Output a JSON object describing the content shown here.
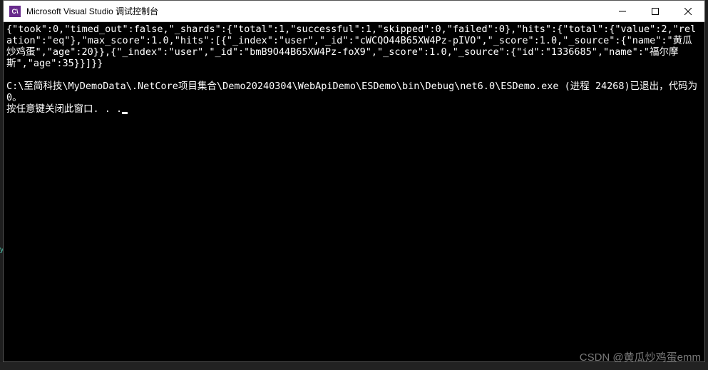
{
  "titlebar": {
    "icon_text": "C\\",
    "title": "Microsoft Visual Studio 调试控制台"
  },
  "console": {
    "json_output": "{\"took\":0,\"timed_out\":false,\"_shards\":{\"total\":1,\"successful\":1,\"skipped\":0,\"failed\":0},\"hits\":{\"total\":{\"value\":2,\"relation\":\"eq\"},\"max_score\":1.0,\"hits\":[{\"_index\":\"user\",\"_id\":\"cWCQO44B65XW4Pz-pIVO\",\"_score\":1.0,\"_source\":{\"name\":\"黄瓜炒鸡蛋\",\"age\":20}},{\"_index\":\"user\",\"_id\":\"bmB9O44B65XW4Pz-foX9\",\"_score\":1.0,\"_source\":{\"id\":\"1336685\",\"name\":\"福尔摩斯\",\"age\":35}}]}}",
    "exit_line": "C:\\至简科技\\MyDemoData\\.NetCore项目集合\\Demo20240304\\WebApiDemo\\ESDemo\\bin\\Debug\\net6.0\\ESDemo.exe (进程 24268)已退出，代码为 0。",
    "prompt_line": "按任意键关闭此窗口. . ."
  },
  "watermark": "CSDN @黄瓜炒鸡蛋emm",
  "gutter": {
    "y_label": "y"
  }
}
